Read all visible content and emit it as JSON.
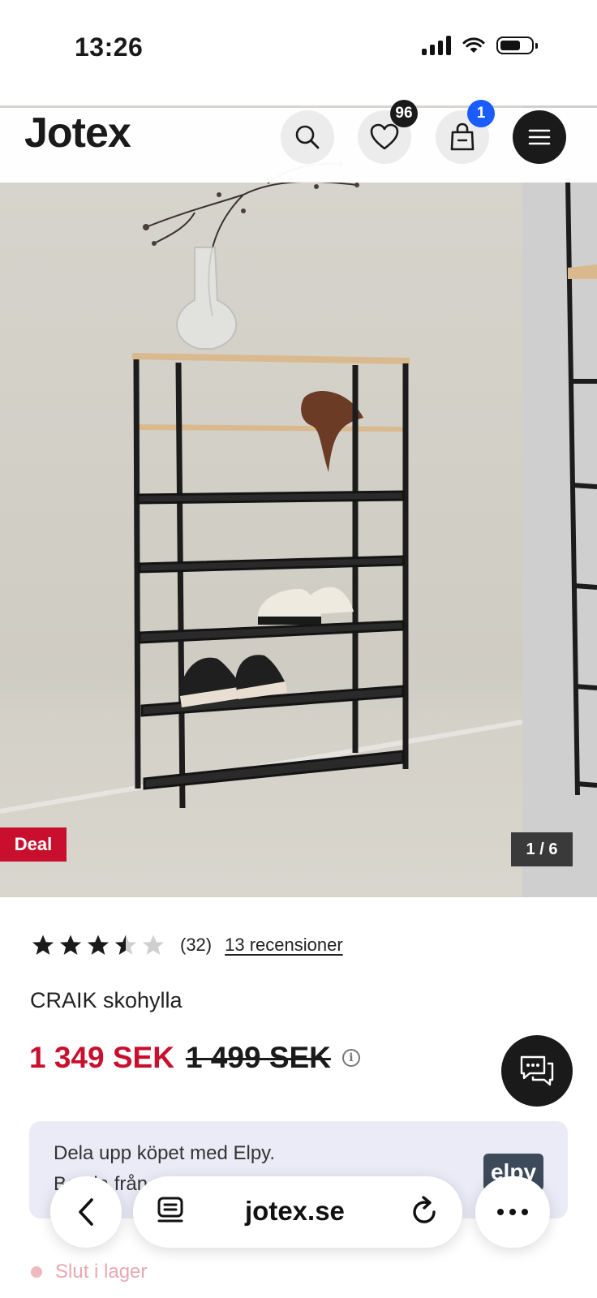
{
  "status_bar": {
    "time": "13:26"
  },
  "header": {
    "logo": "Jotex",
    "wishlist_count": "96",
    "cart_count": "1",
    "brand_color": "#c8102e",
    "cart_badge_color": "#1a5cff",
    "icons": [
      "search-icon",
      "heart-icon",
      "bag-icon",
      "menu-icon"
    ]
  },
  "gallery": {
    "deal_label": "Deal",
    "counter": "1 / 6"
  },
  "product": {
    "rating_value": 3.5,
    "rating_max": 5,
    "rating_count": "(32)",
    "reviews_link": "13 recensioner",
    "title": "CRAIK skohylla",
    "price_sale": "1 349 SEK",
    "price_old": "1 499 SEK"
  },
  "elpy": {
    "line1": "Dela upp köpet med Elpy.",
    "line2": "Betala från",
    "logo": "elpy"
  },
  "stock": {
    "status": "Slut i lager"
  },
  "browser": {
    "url": "jotex.se"
  }
}
